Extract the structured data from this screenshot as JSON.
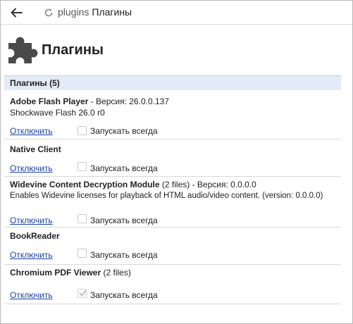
{
  "toolbar": {
    "url": "plugins",
    "page_label": "Плагины"
  },
  "page": {
    "title": "Плагины"
  },
  "section": {
    "header": "Плагины (5)"
  },
  "common": {
    "disable_label": "Отключить",
    "always_run_label": "Запускать всегда"
  },
  "plugins": [
    {
      "name": "Adobe Flash Player",
      "files": "",
      "version_text": " - Версия: 26.0.0.137",
      "description": "Shockwave Flash 26.0 r0",
      "always_run": false
    },
    {
      "name": "Native Client",
      "files": "",
      "version_text": "",
      "description": "",
      "always_run": false
    },
    {
      "name": "Widevine Content Decryption Module",
      "files": " (2 files)",
      "version_text": " - Версия: 0.0.0.0",
      "description": "Enables Widevine licenses for playback of HTML audio/video content. (version: 0.0.0.0)",
      "always_run": false
    },
    {
      "name": "BookReader",
      "files": "",
      "version_text": "",
      "description": "",
      "always_run": false
    },
    {
      "name": "Chromium PDF Viewer",
      "files": " (2 files)",
      "version_text": "",
      "description": "",
      "always_run": true
    }
  ]
}
